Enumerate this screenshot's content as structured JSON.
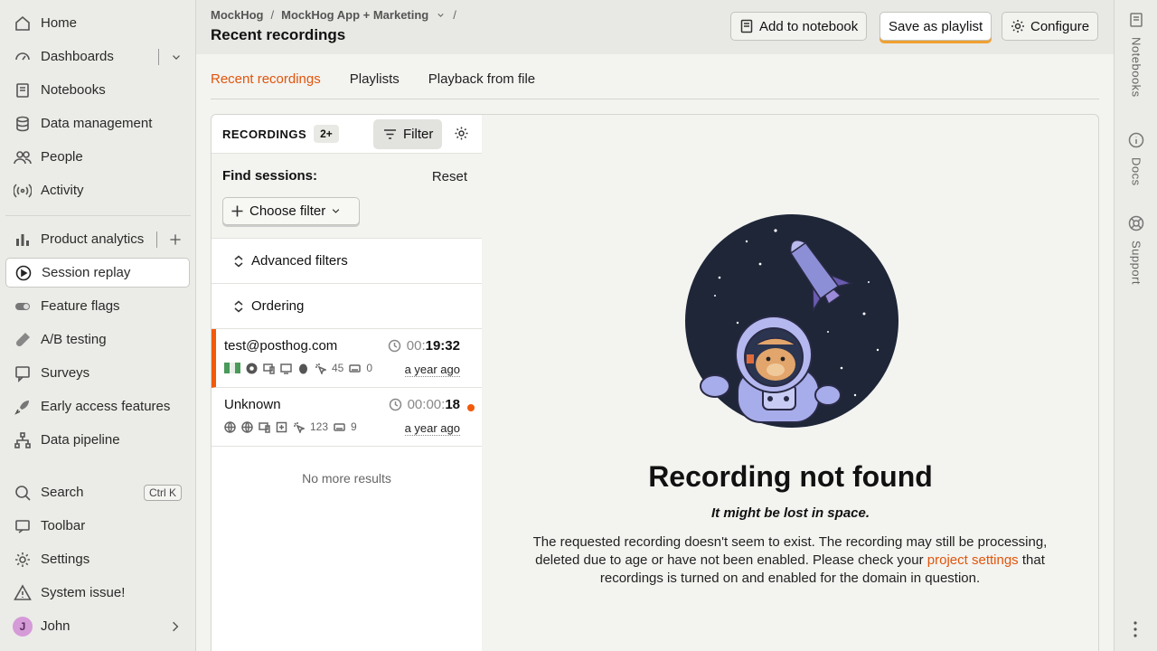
{
  "sidebar": {
    "items": [
      {
        "label": "Home",
        "icon": "home-icon"
      },
      {
        "label": "Dashboards",
        "icon": "dashboard-icon"
      },
      {
        "label": "Notebooks",
        "icon": "notebook-icon"
      },
      {
        "label": "Data management",
        "icon": "database-icon"
      },
      {
        "label": "People",
        "icon": "people-icon"
      },
      {
        "label": "Activity",
        "icon": "activity-icon"
      },
      {
        "label": "Product analytics",
        "icon": "bar-chart-icon"
      },
      {
        "label": "Session replay",
        "icon": "replay-icon"
      },
      {
        "label": "Feature flags",
        "icon": "toggle-icon"
      },
      {
        "label": "A/B testing",
        "icon": "flask-icon"
      },
      {
        "label": "Surveys",
        "icon": "survey-icon"
      },
      {
        "label": "Early access features",
        "icon": "rocket-icon"
      },
      {
        "label": "Data pipeline",
        "icon": "pipeline-icon"
      }
    ],
    "bottom": [
      {
        "label": "Search",
        "icon": "search-icon",
        "shortcut": "Ctrl K"
      },
      {
        "label": "Toolbar",
        "icon": "toolbar-icon"
      },
      {
        "label": "Settings",
        "icon": "gear-icon"
      },
      {
        "label": "System issue!",
        "icon": "warning-icon"
      },
      {
        "label": "John",
        "avatar_letter": "J"
      }
    ]
  },
  "header": {
    "breadcrumb": [
      "MockHog",
      "MockHog App + Marketing"
    ],
    "title": "Recent recordings",
    "buttons": {
      "add_notebook": "Add to notebook",
      "save_playlist": "Save as playlist",
      "configure": "Configure"
    }
  },
  "right_rail": [
    "Notebooks",
    "Docs",
    "Support"
  ],
  "tabs": [
    {
      "label": "Recent recordings",
      "active": true
    },
    {
      "label": "Playlists",
      "active": false
    },
    {
      "label": "Playback from file",
      "active": false
    }
  ],
  "recordings": {
    "title": "RECORDINGS",
    "count": "2+",
    "filter_label": "Filter",
    "find_label": "Find sessions:",
    "reset_label": "Reset",
    "choose_filter": "Choose filter",
    "advanced": "Advanced filters",
    "ordering": "Ordering",
    "items": [
      {
        "person": "test@posthog.com",
        "dur_dim": "00:",
        "dur_strong": "19:32",
        "clicks": "45",
        "keys": "0",
        "ago": "a year ago"
      },
      {
        "person": "Unknown",
        "dur_dim": "00:00:",
        "dur_strong": "18",
        "clicks": "123",
        "keys": "9",
        "ago": "a year ago"
      }
    ],
    "no_more": "No more results"
  },
  "viewer": {
    "title": "Recording not found",
    "subtitle": "It might be lost in space.",
    "desc_before": "The requested recording doesn't seem to exist. The recording may still be processing, deleted due to age or have not been enabled. Please check your ",
    "desc_link": "project settings",
    "desc_after": " that recordings is turned on and enabled for the domain in question."
  },
  "colors": {
    "accent": "#e0550b",
    "selected_bar": "#f25a0a"
  }
}
